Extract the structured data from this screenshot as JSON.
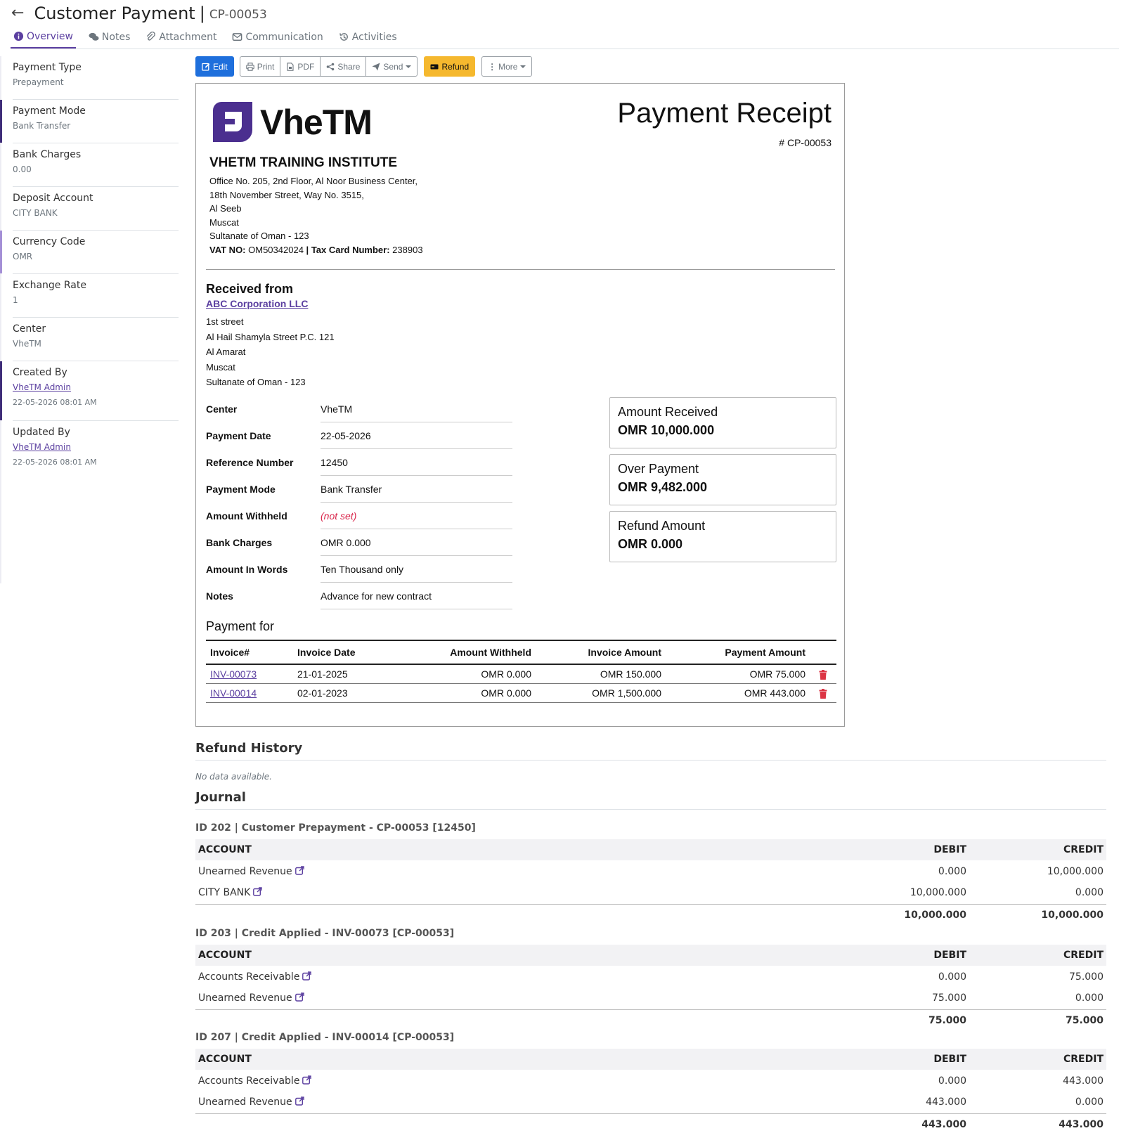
{
  "header": {
    "title": "Customer Payment",
    "separator": "|",
    "subtitle": "CP-00053"
  },
  "tabs": [
    {
      "label": "Overview",
      "icon": "info-circle-icon",
      "active": true
    },
    {
      "label": "Notes",
      "icon": "comments-icon"
    },
    {
      "label": "Attachment",
      "icon": "paperclip-icon"
    },
    {
      "label": "Communication",
      "icon": "envelope-icon"
    },
    {
      "label": "Activities",
      "icon": "history-icon"
    }
  ],
  "sidebar": [
    {
      "label": "Payment Type",
      "value": "Prepayment"
    },
    {
      "label": "Payment Mode",
      "value": "Bank Transfer"
    },
    {
      "label": "Bank Charges",
      "value": "0.00"
    },
    {
      "label": "Deposit Account",
      "value": "CITY BANK"
    },
    {
      "label": "Currency Code",
      "value": "OMR"
    },
    {
      "label": "Exchange Rate",
      "value": "1"
    },
    {
      "label": "Center",
      "value": "VheTM"
    },
    {
      "label": "Created By",
      "link": "VheTM Admin",
      "date": "22-05-2026 08:01 AM"
    },
    {
      "label": "Updated By",
      "link": "VheTM Admin",
      "date": "22-05-2026 08:01 AM"
    }
  ],
  "toolbar": {
    "edit": "Edit",
    "print": "Print",
    "pdf": "PDF",
    "share": "Share",
    "send": "Send",
    "refund": "Refund",
    "more": "More"
  },
  "receipt": {
    "logo_text": "VheTM",
    "title": "Payment Receipt",
    "number": "# CP-00053",
    "company_name": "VHETM TRAINING INSTITUTE",
    "company_address": [
      "Office No. 205, 2nd Floor, Al Noor Business Center,",
      "18th November Street, Way No. 3515,",
      "Al Seeb",
      "Muscat",
      "Sultanate of Oman - 123"
    ],
    "vat_label": "VAT NO:",
    "vat_value": "OM50342024",
    "tax_sep": "|",
    "tax_label": "Tax Card Number:",
    "tax_value": "238903",
    "received_from_title": "Received from",
    "customer_name": "ABC Corporation LLC",
    "customer_address": [
      "1st street",
      "Al Hail Shamyla Street P.C. 121",
      "Al Amarat",
      "Muscat",
      "Sultanate of Oman - 123"
    ],
    "details": [
      {
        "label": "Center",
        "value": "VheTM"
      },
      {
        "label": "Payment Date",
        "value": "22-05-2026"
      },
      {
        "label": "Reference Number",
        "value": "12450"
      },
      {
        "label": "Payment Mode",
        "value": "Bank Transfer"
      },
      {
        "label": "Amount Withheld",
        "value": "(not set)"
      },
      {
        "label": "Bank Charges",
        "value": "OMR 0.000"
      },
      {
        "label": "Amount In Words",
        "value": "Ten Thousand only"
      },
      {
        "label": "Notes",
        "value": "Advance for new contract"
      }
    ],
    "cards": [
      {
        "label": "Amount Received",
        "value": "OMR 10,000.000"
      },
      {
        "label": "Over Payment",
        "value": "OMR 9,482.000"
      },
      {
        "label": "Refund Amount",
        "value": "OMR 0.000"
      }
    ],
    "payment_for_title": "Payment for",
    "invoice_columns": [
      "Invoice#",
      "Invoice Date",
      "Amount Withheld",
      "Invoice Amount",
      "Payment Amount"
    ],
    "invoices": [
      {
        "number": "INV-00073",
        "date": "21-01-2025",
        "withheld": "OMR 0.000",
        "amount": "OMR 150.000",
        "payment": "OMR 75.000"
      },
      {
        "number": "INV-00014",
        "date": "02-01-2023",
        "withheld": "OMR 0.000",
        "amount": "OMR 1,500.000",
        "payment": "OMR 443.000"
      }
    ]
  },
  "refund_history": {
    "title": "Refund History",
    "empty": "No data available."
  },
  "journal": {
    "title": "Journal",
    "columns": [
      "ACCOUNT",
      "DEBIT",
      "CREDIT"
    ],
    "entries": [
      {
        "heading": "ID 202 | Customer Prepayment - CP-00053 [12450]",
        "rows": [
          {
            "account": "Unearned Revenue",
            "debit": "0.000",
            "credit": "10,000.000"
          },
          {
            "account": "CITY BANK",
            "debit": "10,000.000",
            "credit": "0.000"
          }
        ],
        "total_debit": "10,000.000",
        "total_credit": "10,000.000"
      },
      {
        "heading": "ID 203 | Credit Applied - INV-00073 [CP-00053]",
        "rows": [
          {
            "account": "Accounts Receivable",
            "debit": "0.000",
            "credit": "75.000"
          },
          {
            "account": "Unearned Revenue",
            "debit": "75.000",
            "credit": "0.000"
          }
        ],
        "total_debit": "75.000",
        "total_credit": "75.000"
      },
      {
        "heading": "ID 207 | Credit Applied - INV-00014 [CP-00053]",
        "rows": [
          {
            "account": "Accounts Receivable",
            "debit": "0.000",
            "credit": "443.000"
          },
          {
            "account": "Unearned Revenue",
            "debit": "443.000",
            "credit": "0.000"
          }
        ],
        "total_debit": "443.000",
        "total_credit": "443.000"
      }
    ]
  },
  "colors": {
    "primary": "#1e6fdc",
    "accent": "#5b3fa0",
    "warning": "#f5b82e",
    "danger": "#dc3545"
  }
}
